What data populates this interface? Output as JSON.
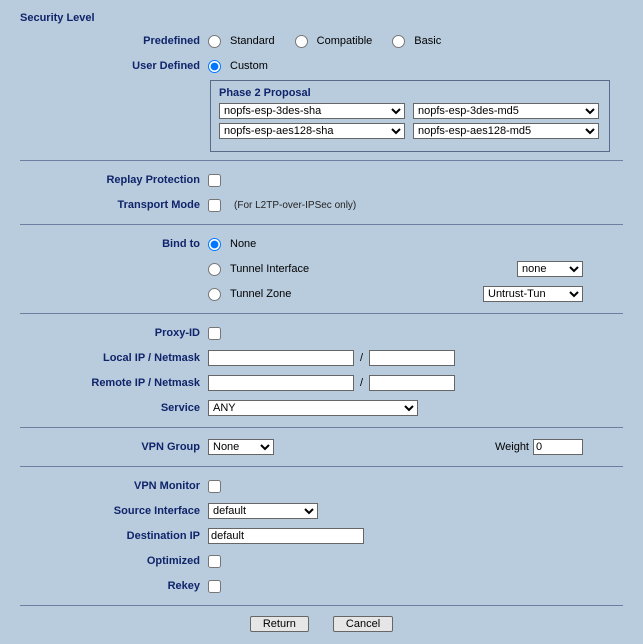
{
  "title": "Security Level",
  "predefined": {
    "label": "Predefined",
    "options": {
      "standard": "Standard",
      "compatible": "Compatible",
      "basic": "Basic"
    }
  },
  "userDefined": {
    "label": "User Defined",
    "custom": "Custom"
  },
  "proposal": {
    "title": "Phase 2 Proposal",
    "p1": "nopfs-esp-3des-sha",
    "p2": "nopfs-esp-3des-md5",
    "p3": "nopfs-esp-aes128-sha",
    "p4": "nopfs-esp-aes128-md5"
  },
  "replay": {
    "label": "Replay Protection"
  },
  "transport": {
    "label": "Transport Mode",
    "hint": "(For L2TP-over-IPSec only)"
  },
  "bind": {
    "label": "Bind to",
    "none": "None",
    "tunnelIf": "Tunnel Interface",
    "tunnelZone": "Tunnel Zone",
    "ifSel": "none",
    "zoneSel": "Untrust-Tun"
  },
  "proxy": {
    "label": "Proxy-ID"
  },
  "localip": {
    "label": "Local IP / Netmask",
    "ip": "",
    "mask": ""
  },
  "remoteip": {
    "label": "Remote IP / Netmask",
    "ip": "",
    "mask": ""
  },
  "service": {
    "label": "Service",
    "value": "ANY"
  },
  "vpngroup": {
    "label": "VPN Group",
    "value": "None",
    "weightLabel": "Weight",
    "weight": "0"
  },
  "vpnmon": {
    "label": "VPN Monitor"
  },
  "srcif": {
    "label": "Source Interface",
    "value": "default"
  },
  "destip": {
    "label": "Destination IP",
    "value": "default"
  },
  "optimized": {
    "label": "Optimized"
  },
  "rekey": {
    "label": "Rekey"
  },
  "buttons": {
    "return": "Return",
    "cancel": "Cancel"
  },
  "slash": "/"
}
